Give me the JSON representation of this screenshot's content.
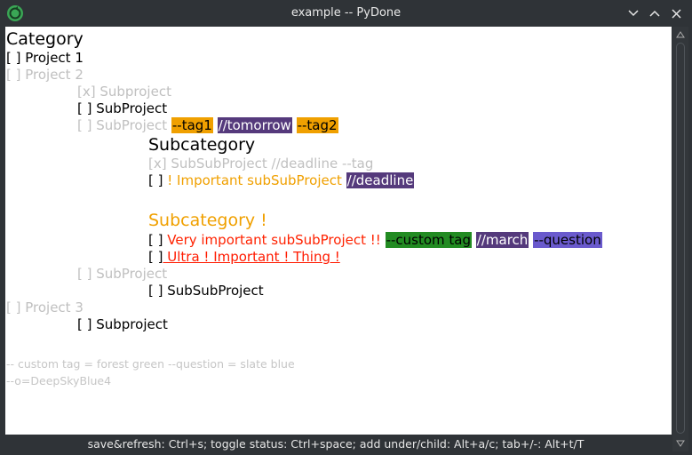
{
  "window": {
    "title": "example -- PyDone",
    "app_icon": "pydone-green-circle-icon",
    "controls": [
      "minimize-icon",
      "maximize-icon",
      "close-icon"
    ]
  },
  "editor": {
    "l1": "Category",
    "l2": "[ ] Project 1",
    "l3": "[ ] Project 2",
    "l4": "[x] Subproject",
    "l5": "[ ] SubProject",
    "l6_pre": "[ ] SubProject ",
    "l6_tag1": "--tag1",
    "l6_tag2": "//tomorrow",
    "l6_tag3": "--tag2",
    "l7": "Subcategory",
    "l8": "[x] SubSubProject //deadline --tag",
    "l9_pre": "[ ] ",
    "l9_text": "! Important subSubProject",
    "l9_tag": "//deadline",
    "l10": "Subcategory !",
    "l11_pre": "[ ] ",
    "l11_text": "Very important subSubProject !!",
    "l11_tag1": "--custom tag",
    "l11_tag2": "//march",
    "l11_tag3": "--question",
    "l12_pre": "[ ]",
    "l12_text": " Ultra ! Important ! Thing !",
    "l13": "[ ] SubProject",
    "l14": "[ ] SubSubProject",
    "l15": "[ ] Project 3",
    "l16": "[ ] Subproject",
    "c1": "-- custom tag = forest green --question = slate blue",
    "c2": "--o=DeepSkyBlue4"
  },
  "statusbar": {
    "text": "save&refresh: Ctrl+s; toggle status: Ctrl+space; add under/child: Alt+a/c; tab+/-: Alt+t/T"
  },
  "colors": {
    "tag_orange": "#f0a000",
    "tag_purple": "#553a7c",
    "forest_green": "#228b22",
    "slate_blue": "#6a5acd",
    "important": "#ff2200"
  }
}
